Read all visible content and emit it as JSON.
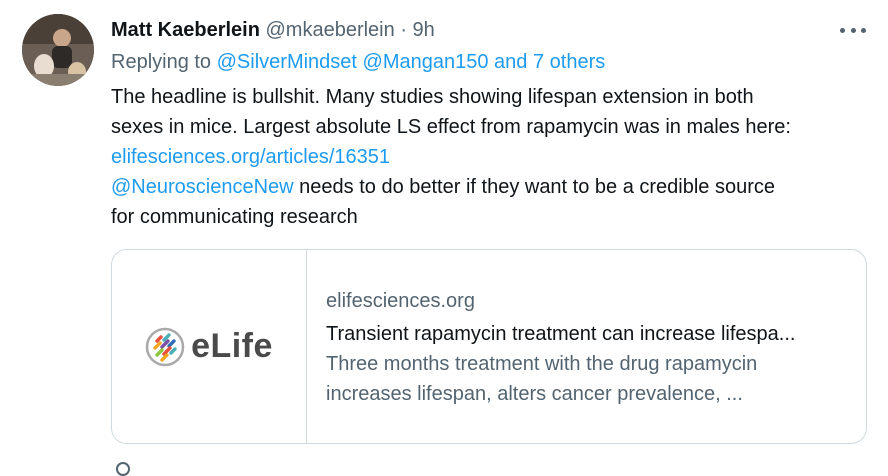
{
  "tweet": {
    "author_name": "Matt Kaeberlein",
    "author_handle": "@mkaeberlein",
    "separator": "·",
    "time": "9h",
    "replying_prefix": "Replying to ",
    "replying_mentions": [
      "@SilverMindset",
      "@Mangan150"
    ],
    "replying_others": "and 7 others",
    "text_line1": "The headline is bullshit. Many studies showing lifespan extension in both",
    "text_line2": "sexes in mice. Largest absolute LS effect from rapamycin was in males here:",
    "text_link": "elifesciences.org/articles/16351",
    "text_mention": "@NeuroscienceNew",
    "text_line4_rest": " needs to do better if they want to be a credible source",
    "text_line5": "for communicating research"
  },
  "card": {
    "logo_text": "eLife",
    "domain": "elifesciences.org",
    "title": "Transient rapamycin treatment can increase lifespa...",
    "desc_line1": "Three months treatment with the drug rapamycin",
    "desc_line2": "increases lifespan, alters cancer prevalence, ..."
  },
  "icons": {
    "more": "more-horizontal-icon",
    "logo": "elife-logo-icon"
  },
  "colors": {
    "link": "#1d9bf0",
    "secondary_text": "#536471",
    "border": "#cfd9de"
  }
}
